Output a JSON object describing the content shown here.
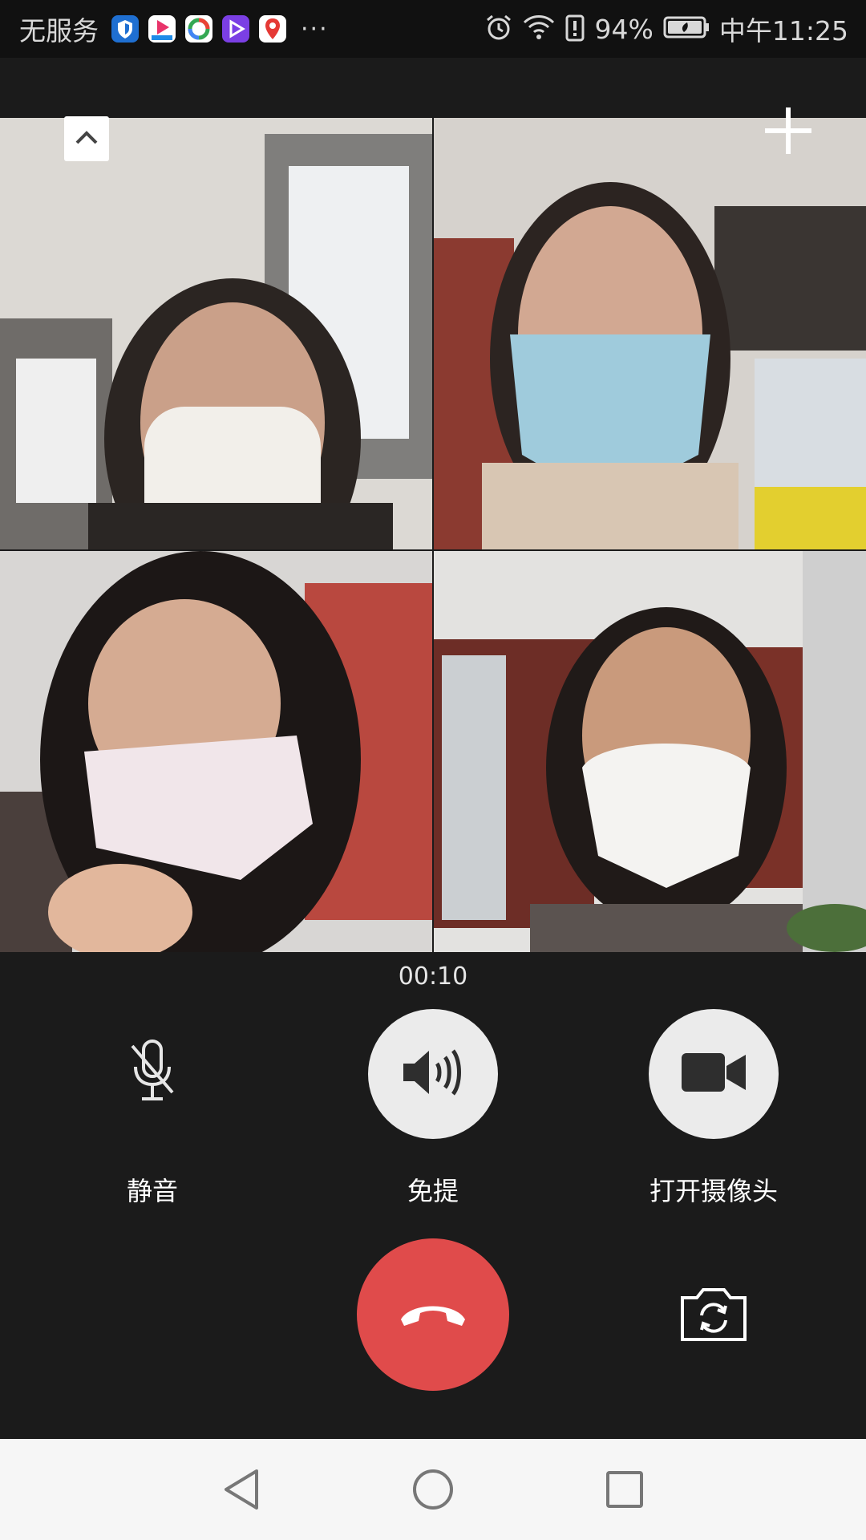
{
  "status_bar": {
    "carrier": "无服务",
    "notification_icons": [
      "shield-app-icon",
      "youku-app-icon",
      "photo-app-icon",
      "video-app-icon",
      "map-app-icon"
    ],
    "overflow": "···",
    "system_icons": [
      "alarm-icon",
      "wifi-icon",
      "battery-alert-icon"
    ],
    "battery_percent": "94%",
    "time": "中午11:25"
  },
  "video_call": {
    "participants": [
      "participant-1",
      "participant-2",
      "participant-3",
      "participant-4"
    ],
    "timer": "00:10",
    "controls": {
      "mute_label": "静音",
      "speaker_label": "免提",
      "camera_label": "打开摄像头"
    }
  },
  "colors": {
    "background": "#1b1b1b",
    "hangup": "#e04b4b",
    "control_circle": "#ebebeb",
    "nav_bar": "#f6f6f6"
  },
  "nav_bar": {
    "buttons": [
      "back",
      "home",
      "recent-apps"
    ]
  }
}
